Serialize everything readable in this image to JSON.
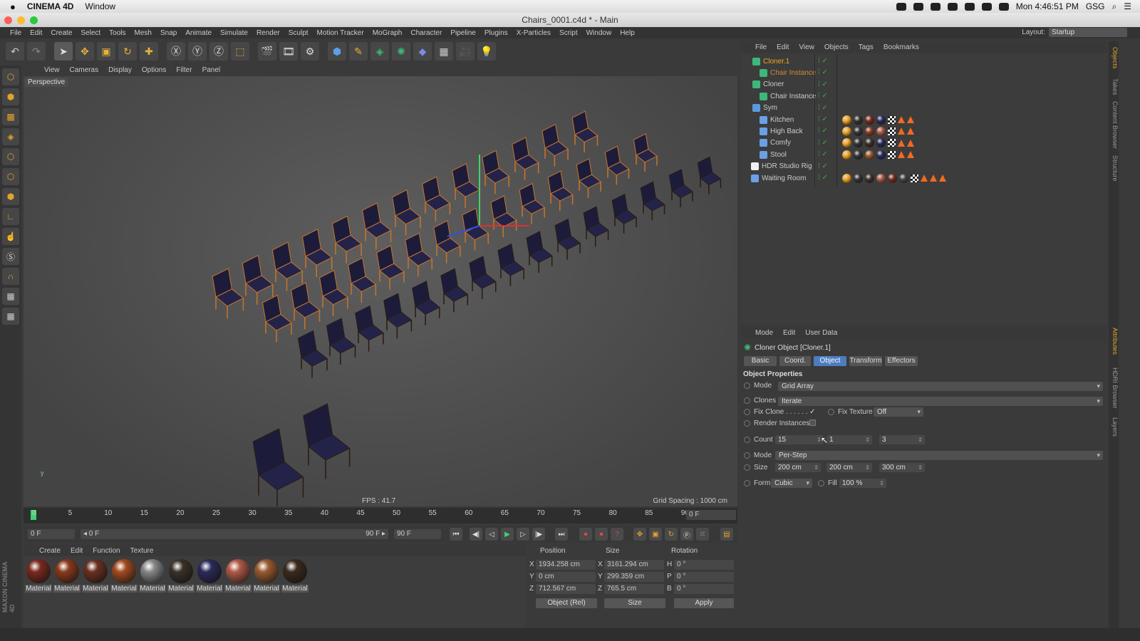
{
  "mac": {
    "app_name": "CINEMA 4D",
    "menu_window": "Window",
    "clock": "Mon 4:46:51 PM",
    "user": "GSG"
  },
  "window": {
    "title": "Chairs_0001.c4d * - Main"
  },
  "menu": [
    "File",
    "Edit",
    "Create",
    "Select",
    "Tools",
    "Mesh",
    "Snap",
    "Animate",
    "Simulate",
    "Render",
    "Sculpt",
    "Motion Tracker",
    "MoGraph",
    "Character",
    "Pipeline",
    "Plugins",
    "X-Particles",
    "Script",
    "Window",
    "Help"
  ],
  "layout": {
    "label": "Layout:",
    "value": "Startup"
  },
  "viewport": {
    "menu": [
      "View",
      "Cameras",
      "Display",
      "Options",
      "Filter",
      "Panel"
    ],
    "camera_label": "Perspective",
    "fps": "FPS : 41.7",
    "grid_spacing": "Grid Spacing : 1000 cm"
  },
  "timeline": {
    "ticks": [
      "0",
      "5",
      "10",
      "15",
      "20",
      "25",
      "30",
      "35",
      "40",
      "45",
      "50",
      "55",
      "60",
      "65",
      "70",
      "75",
      "80",
      "85",
      "90"
    ],
    "current_frame": "0 F",
    "start_field": "0 F",
    "range_left": "◂ 0 F",
    "range_right": "90 F ▸",
    "end_field": "90 F"
  },
  "materials": {
    "menu": [
      "Create",
      "Edit",
      "Function",
      "Texture"
    ],
    "items": [
      {
        "label": "Material",
        "color": "#7a2a1e"
      },
      {
        "label": "Material",
        "color": "#8a3a1c"
      },
      {
        "label": "Material",
        "color": "#6a3020"
      },
      {
        "label": "Material",
        "color": "#a24a20"
      },
      {
        "label": "Material",
        "color": "#888888"
      },
      {
        "label": "Material",
        "color": "#3a3028"
      },
      {
        "label": "Material",
        "color": "#2a2a5a"
      },
      {
        "label": "Material",
        "color": "#b05a48"
      },
      {
        "label": "Material",
        "color": "#9a5a30"
      },
      {
        "label": "Material",
        "color": "#3a2a1e"
      }
    ]
  },
  "coords": {
    "headers": {
      "position": "Position",
      "size": "Size",
      "rotation": "Rotation"
    },
    "rows": [
      {
        "axis": "X",
        "pos": "1934.258 cm",
        "saxis": "X",
        "size": "3161.294 cm",
        "raxis": "H",
        "rot": "0 °"
      },
      {
        "axis": "Y",
        "pos": "0 cm",
        "saxis": "Y",
        "size": "299.359 cm",
        "raxis": "P",
        "rot": "0 °"
      },
      {
        "axis": "Z",
        "pos": "712.567 cm",
        "saxis": "Z",
        "size": "765.5 cm",
        "raxis": "B",
        "rot": "0 °"
      }
    ],
    "mode": "Object (Rel)",
    "size_mode": "Size",
    "apply": "Apply"
  },
  "objects": {
    "menu": [
      "File",
      "Edit",
      "View",
      "Objects",
      "Tags",
      "Bookmarks"
    ],
    "items": [
      {
        "name": "Cloner.1",
        "color": "#f5a623"
      },
      {
        "name": "Chair Instance",
        "color": "#d08a3a"
      },
      {
        "name": "Cloner",
        "color": "#cccccc"
      },
      {
        "name": "Chair Instance",
        "color": "#cccccc"
      },
      {
        "name": "Sym",
        "color": "#cccccc"
      },
      {
        "name": "Kitchen",
        "color": "#cccccc"
      },
      {
        "name": "High Back",
        "color": "#cccccc"
      },
      {
        "name": "Comfy",
        "color": "#cccccc"
      },
      {
        "name": "Stool",
        "color": "#cccccc"
      },
      {
        "name": "HDR Studio Rig",
        "color": "#cccccc"
      },
      {
        "name": "Waiting Room",
        "color": "#cccccc"
      }
    ]
  },
  "attributes": {
    "menu": [
      "Mode",
      "Edit",
      "User Data"
    ],
    "object_title": "Cloner Object [Cloner.1]",
    "tabs": [
      "Basic",
      "Coord.",
      "Object",
      "Transform",
      "Effectors"
    ],
    "section": "Object Properties",
    "mode_label": "Mode",
    "mode_value": "Grid Array",
    "clones_label": "Clones",
    "clones_value": "Iterate",
    "fix_clone_label": "Fix Clone . . . . . .",
    "fix_clone_check": "✓",
    "fix_texture_label": "Fix Texture",
    "fix_texture_value": "Off",
    "render_instances_label": "Render Instances",
    "count_label": "Count",
    "count": [
      "15",
      "1",
      "3"
    ],
    "mode2_label": "Mode",
    "mode2_value": "Per-Step",
    "size_label": "Size",
    "size": [
      "200 cm",
      "200 cm",
      "300 cm"
    ],
    "form_label": "Form",
    "form_value": "Cubic",
    "fill_label": "Fill",
    "fill_value": "100 %"
  },
  "right_tabs": [
    "Objects",
    "Takes",
    "Content Browser",
    "Structure",
    "Attributes",
    "HDRI Browser",
    "Layers"
  ],
  "brand": "MAXON CINEMA 4D"
}
